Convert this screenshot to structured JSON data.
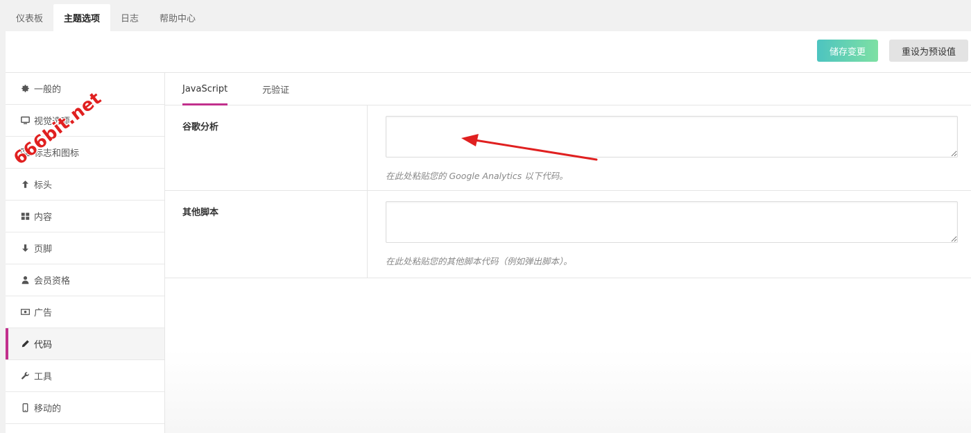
{
  "top_tabs": [
    {
      "label": "仪表板"
    },
    {
      "label": "主题选项"
    },
    {
      "label": "日志"
    },
    {
      "label": "帮助中心"
    }
  ],
  "toolbar": {
    "save_label": "储存变更",
    "reset_label": "重设为预设值"
  },
  "sidebar": {
    "items": [
      {
        "label": "一般的",
        "icon": "gear-icon"
      },
      {
        "label": "视觉选项",
        "icon": "monitor-icon"
      },
      {
        "label": "标志和图标",
        "icon": "image-icon"
      },
      {
        "label": "标头",
        "icon": "arrow-up-icon"
      },
      {
        "label": "内容",
        "icon": "grid-icon"
      },
      {
        "label": "页脚",
        "icon": "arrow-down-icon"
      },
      {
        "label": "会员资格",
        "icon": "user-icon"
      },
      {
        "label": "广告",
        "icon": "money-icon"
      },
      {
        "label": "代码",
        "icon": "pencil-icon"
      },
      {
        "label": "工具",
        "icon": "wrench-icon"
      },
      {
        "label": "移动的",
        "icon": "mobile-icon"
      }
    ],
    "active": "代码"
  },
  "subtabs": [
    {
      "label": "JavaScript"
    },
    {
      "label": "元验证"
    }
  ],
  "fields": {
    "analytics": {
      "label": "谷歌分析",
      "value": "",
      "help": "在此处粘贴您的 Google Analytics 以下代码。"
    },
    "other_scripts": {
      "label": "其他脚本",
      "value": "",
      "help": "在此处粘贴您的其他脚本代码（例如弹出脚本）。"
    }
  },
  "watermark": "666bit.net",
  "colors": {
    "accent": "#c12f8c",
    "save_gradient_start": "#4dc4c0",
    "save_gradient_end": "#7ee0a3",
    "arrow": "#e02020"
  }
}
